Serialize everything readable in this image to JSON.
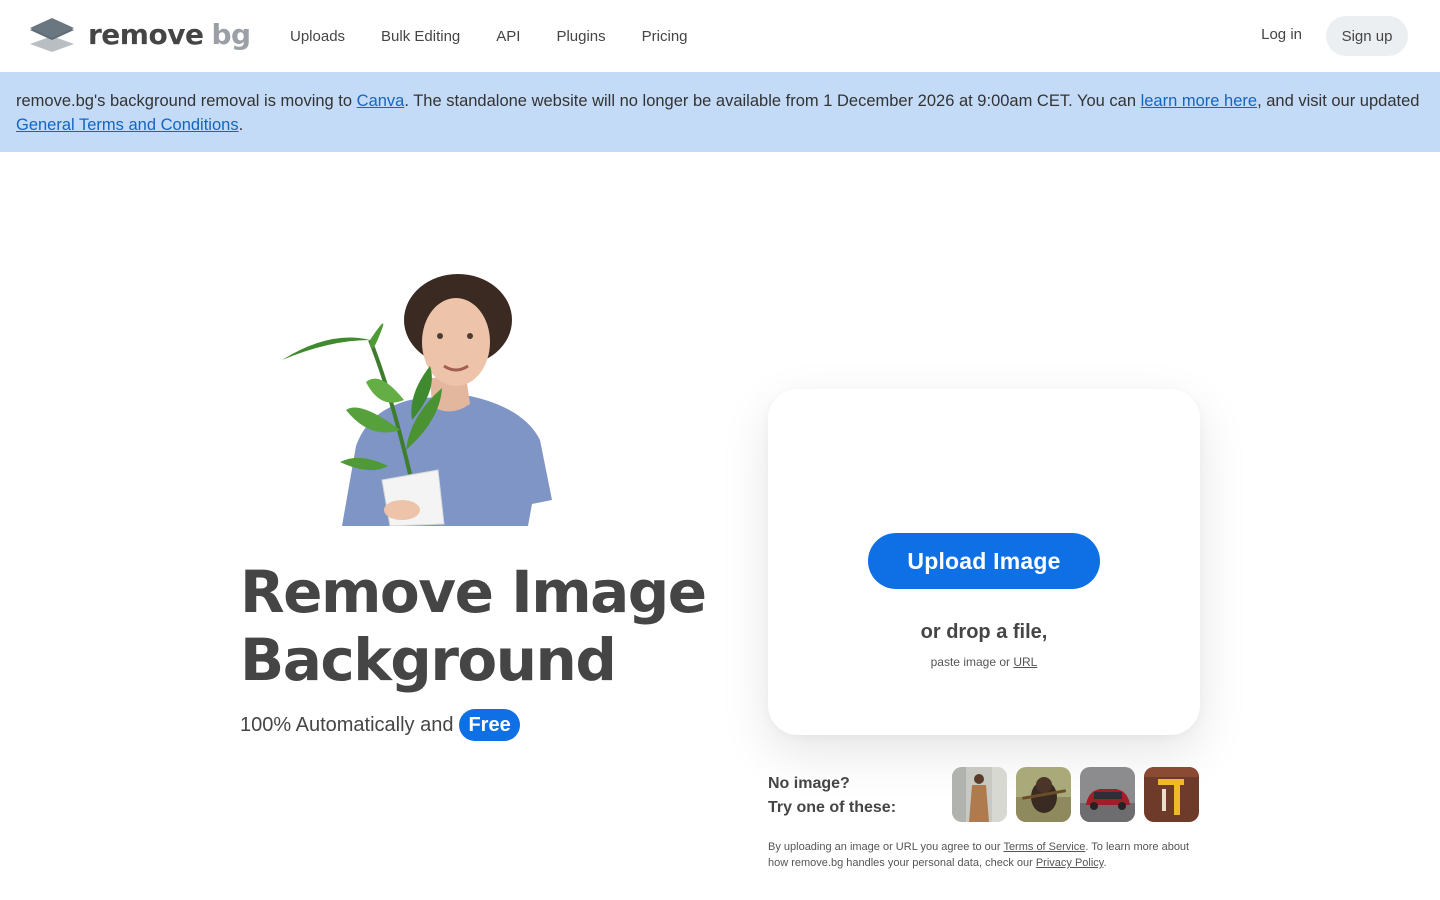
{
  "header": {
    "logo_word1": "remove",
    "logo_word2": "bg",
    "nav": [
      "Uploads",
      "Bulk Editing",
      "API",
      "Plugins",
      "Pricing"
    ],
    "login_label": "Log in",
    "signup_label": "Sign up"
  },
  "banner": {
    "t1": "remove.bg's background removal is moving to ",
    "link1": "Canva",
    "t2": ". The standalone website will no longer be available from 1 December 2026 at 9:00am CET. You can ",
    "link2": "learn more here",
    "t3": ", and visit our updated ",
    "link3": "General Terms and Conditions",
    "t4": "."
  },
  "hero": {
    "title_line1": "Remove Image",
    "title_line2": "Background",
    "subtitle": "100% Automatically and",
    "badge": "Free"
  },
  "upload": {
    "button_label": "Upload Image",
    "drop_text": "or drop a file,",
    "paste_prefix": "paste image or ",
    "paste_link": "URL"
  },
  "samples": {
    "line1": "No image?",
    "line2": "Try one of these:",
    "thumbs": [
      "sample-woman",
      "sample-dog",
      "sample-car",
      "sample-object"
    ]
  },
  "legal": {
    "t1": "By uploading an image or URL you agree to our ",
    "link1": "Terms of Service",
    "t2": ". To learn more about how remove.bg handles your personal data, check our ",
    "link2": "Privacy Policy",
    "t3": "."
  },
  "colors": {
    "accent": "#0f70e6",
    "banner_bg": "#c3dbf7",
    "text": "#454545"
  }
}
